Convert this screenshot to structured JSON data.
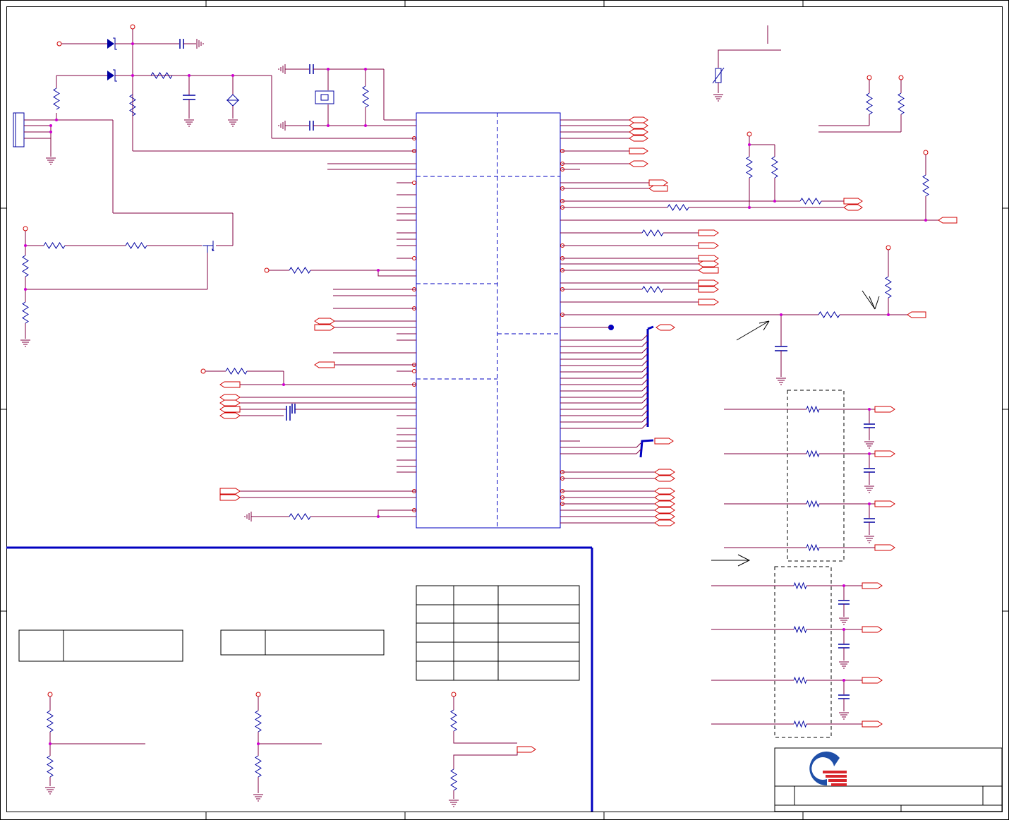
{
  "colors": {
    "wire": "#800040",
    "component": "#0000a0",
    "port": "#d00000",
    "bus": "#0000c0",
    "junction": "#d000d0",
    "frame": "#000000",
    "logo_blue": "#1f4fa8",
    "logo_red": "#d8262c"
  },
  "icons": {
    "company_logo": "company-logo",
    "resistor": "resistor-icon",
    "capacitor": "capacitor-icon",
    "ground": "ground-icon",
    "diode": "diode-icon",
    "transistor": "transistor-icon",
    "crystal": "crystal-icon",
    "connector": "connector-icon"
  }
}
